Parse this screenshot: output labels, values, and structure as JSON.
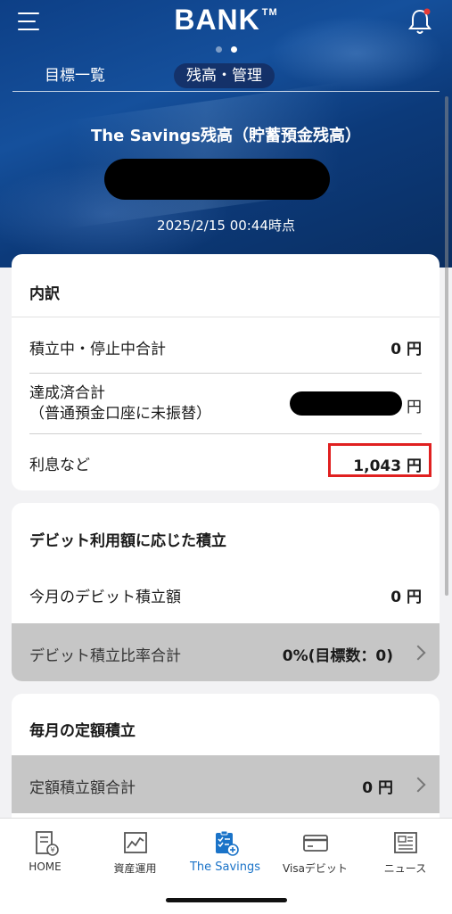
{
  "header": {
    "brand": "BANK",
    "trademark": "TM",
    "menu_icon": "hamburger-menu-icon",
    "bell_icon": "bell-icon",
    "notification_dot_color": "#e53935",
    "page_dots": 2,
    "active_page_dot": 2
  },
  "tabs": [
    {
      "label": "目標一覧",
      "active": false
    },
    {
      "label": "残高・管理",
      "active": true
    }
  ],
  "hero": {
    "title": "The Savings残高（貯蓄預金残高）",
    "updated_at": "2025/2/15 00:44時点",
    "balance_redacted": true
  },
  "breakdown": {
    "title": "内訳",
    "rows": [
      {
        "label": "積立中・停止中合計",
        "value": "0 円"
      },
      {
        "label_line1": "達成済合計",
        "label_line2": "（普通預金口座に未振替）",
        "unit": "円",
        "redacted": true
      },
      {
        "label": "利息など",
        "value": "1,043 円",
        "highlight_color": "#e02020"
      }
    ]
  },
  "debit": {
    "title": "デビット利用額に応じた積立",
    "monthly_label": "今月のデビット積立額",
    "monthly_value": "0 円",
    "ratio_label": "デビット積立比率合計",
    "ratio_value": "0%(目標数：0)"
  },
  "fixed": {
    "title": "毎月の定額積立",
    "total_label": "定額積立額合計",
    "total_value": "0 円"
  },
  "tabbar": {
    "active_color": "#1a73c8",
    "items": [
      {
        "label": "HOME",
        "icon": "home-receipt-icon",
        "active": false
      },
      {
        "label": "資産運用",
        "icon": "chart-icon",
        "active": false
      },
      {
        "label": "The Savings",
        "icon": "savings-checklist-icon",
        "active": true
      },
      {
        "label": "Visaデビット",
        "icon": "card-icon",
        "active": false
      },
      {
        "label": "ニュース",
        "icon": "news-icon",
        "active": false
      }
    ]
  }
}
